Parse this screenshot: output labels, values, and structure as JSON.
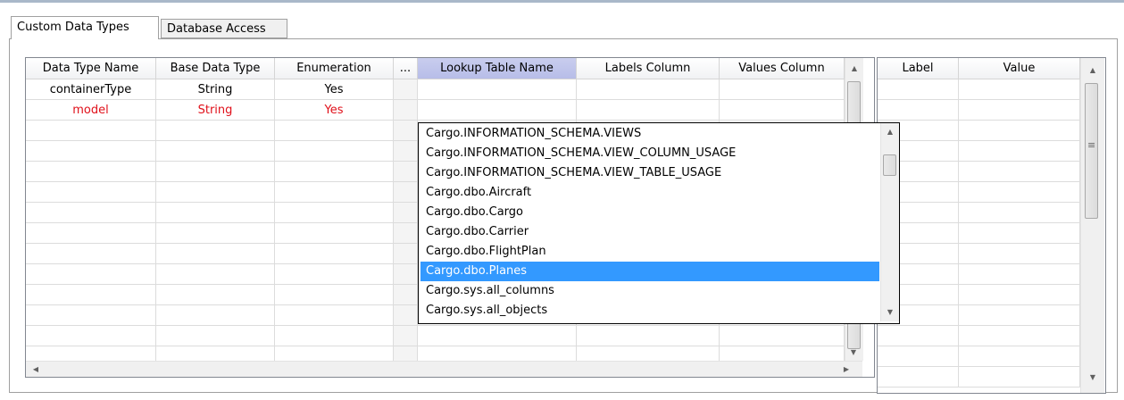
{
  "tabs": [
    {
      "label": "Custom Data Types",
      "active": true
    },
    {
      "label": "Database Access",
      "active": false
    }
  ],
  "grid": {
    "headers": [
      "Data Type Name",
      "Base Data Type",
      "Enumeration",
      "...",
      "Lookup Table Name",
      "Labels Column",
      "Values Column"
    ],
    "selected_header": "Lookup Table Name",
    "rows": [
      {
        "name": "containerType",
        "base": "String",
        "enumeration": "Yes",
        "highlight": false
      },
      {
        "name": "model",
        "base": "String",
        "enumeration": "Yes",
        "highlight": true
      }
    ],
    "highlight_color": "#e0101a"
  },
  "side_grid": {
    "headers": [
      "Label",
      "Value"
    ]
  },
  "dropdown": {
    "items": [
      "Cargo.INFORMATION_SCHEMA.VIEWS",
      "Cargo.INFORMATION_SCHEMA.VIEW_COLUMN_USAGE",
      "Cargo.INFORMATION_SCHEMA.VIEW_TABLE_USAGE",
      "Cargo.dbo.Aircraft",
      "Cargo.dbo.Cargo",
      "Cargo.dbo.Carrier",
      "Cargo.dbo.FlightPlan",
      "Cargo.dbo.Planes",
      "Cargo.sys.all_columns",
      "Cargo.sys.all_objects"
    ],
    "selected": "Cargo.dbo.Planes",
    "selection_color": "#3399ff"
  },
  "icons": {
    "up": "▲",
    "down": "▼",
    "left": "◀",
    "right": "▶",
    "grip": "≡"
  }
}
